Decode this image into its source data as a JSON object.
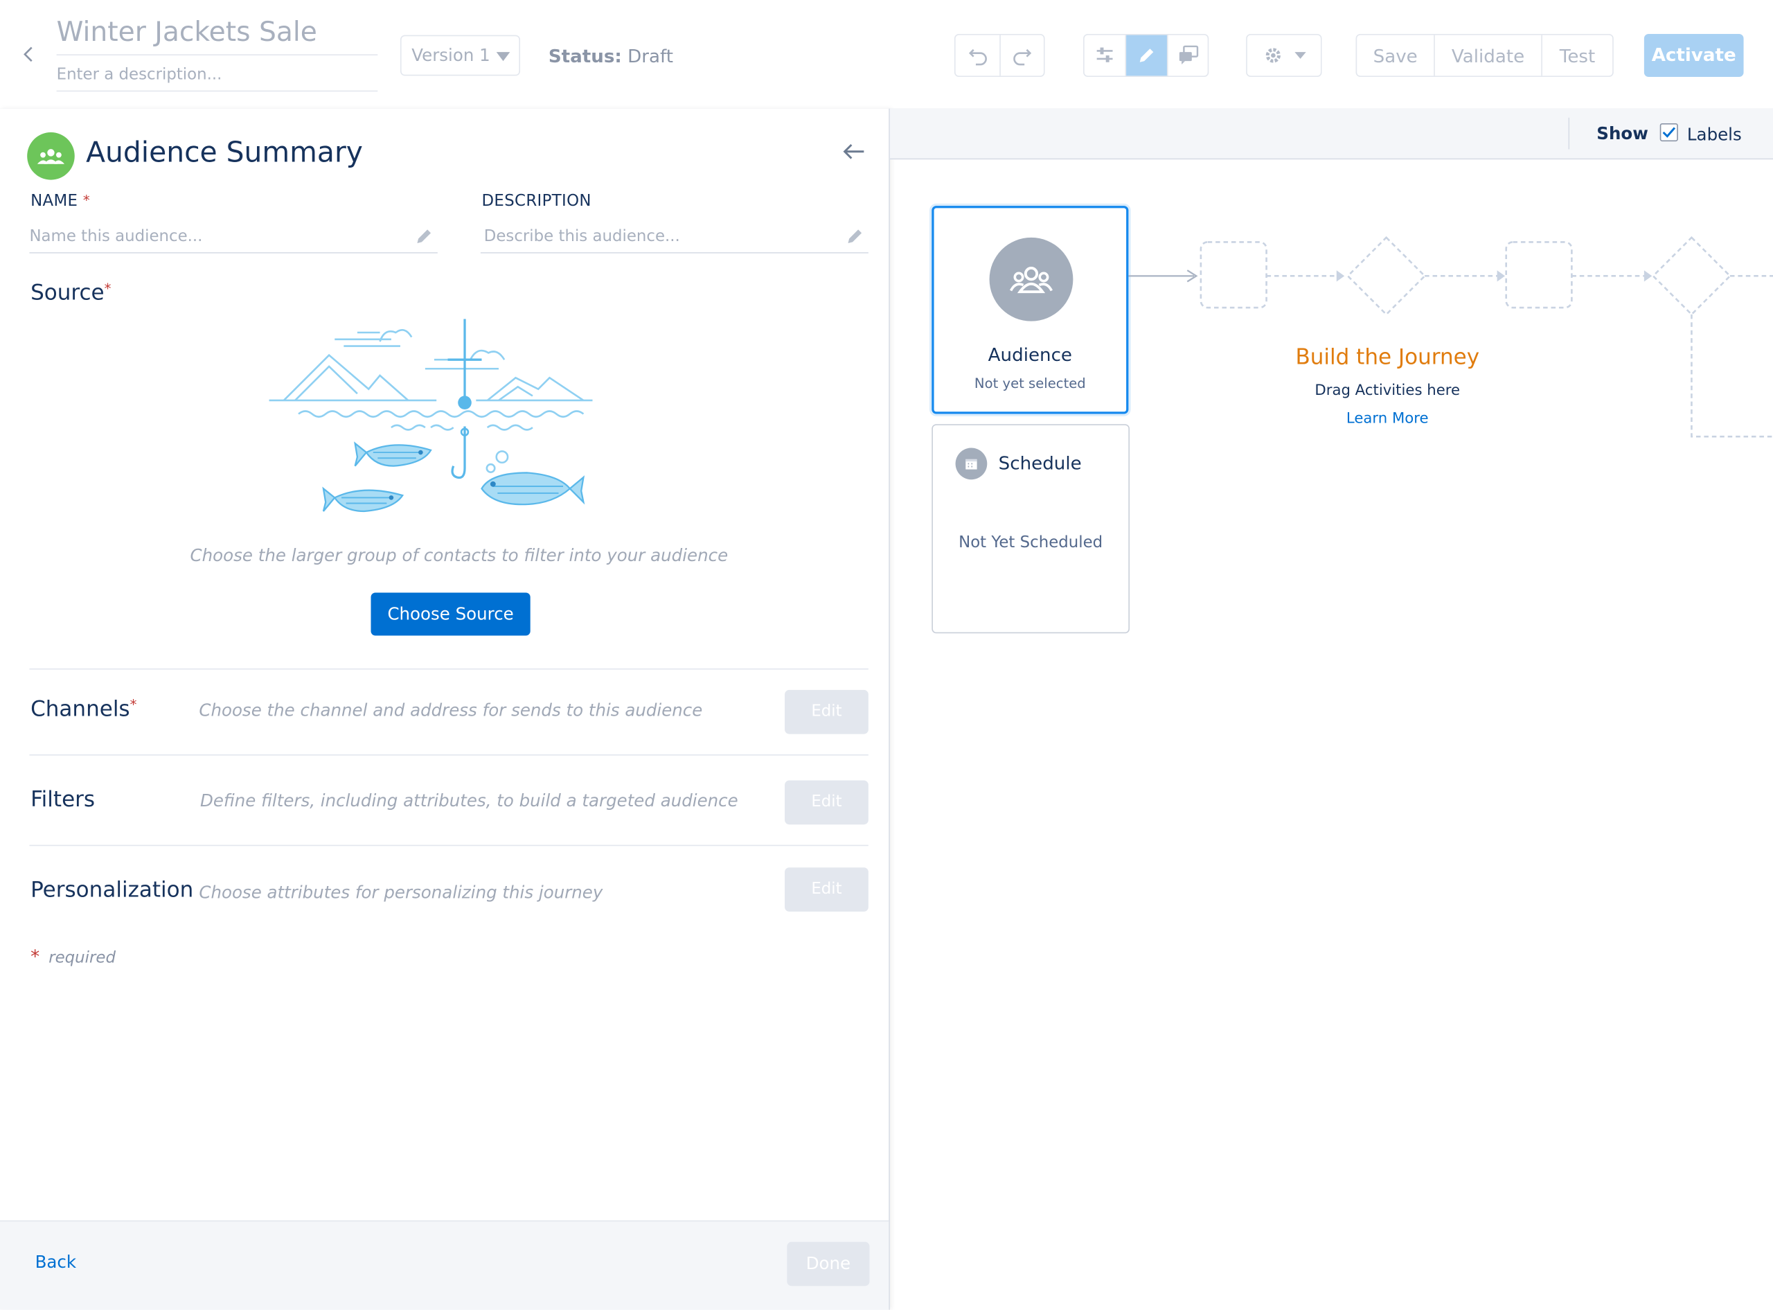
{
  "header": {
    "title": "Winter Jackets Sale",
    "description_placeholder": "Enter a description...",
    "version": "Version 1",
    "status_label": "Status:",
    "status_value": "Draft",
    "save_label": "Save",
    "validate_label": "Validate",
    "test_label": "Test",
    "activate_label": "Activate",
    "icons": [
      "undo-icon",
      "redo-icon",
      "settings-sliders-icon",
      "pencil-icon",
      "comments-icon",
      "gear-icon",
      "chevron-down-icon"
    ]
  },
  "panel": {
    "title": "Audience Summary",
    "name_label": "NAME",
    "name_placeholder": "Name this audience...",
    "description_label": "DESCRIPTION",
    "description_placeholder": "Describe this audience...",
    "source_title": "Source",
    "source_help": "Choose the larger group of contacts to filter into your audience",
    "choose_source_label": "Choose Source",
    "rows": [
      {
        "title": "Channels",
        "required": true,
        "desc": "Choose the channel and address for sends to this audience",
        "edit": "Edit"
      },
      {
        "title": "Filters",
        "required": false,
        "desc": "Define filters, including attributes, to build a targeted audience",
        "edit": "Edit"
      },
      {
        "title": "Personalization",
        "required": false,
        "desc": "Choose attributes for personalizing this journey",
        "edit": "Edit"
      }
    ],
    "required_asterisk": "*",
    "required_note": "required",
    "footer_back": "Back",
    "footer_done": "Done"
  },
  "canvas": {
    "show_label": "Show",
    "labels_label": "Labels",
    "labels_checked": true,
    "audience_title": "Audience",
    "audience_sub": "Not yet selected",
    "schedule_title": "Schedule",
    "schedule_sub": "Not Yet Scheduled",
    "build_title": "Build the Journey",
    "build_sub": "Drag Activities here",
    "learn_more": "Learn More"
  },
  "colors": {
    "brand_blue": "#0070d2",
    "disabled_blue": "#a9d1f3",
    "audience_green": "#6dc55a",
    "build_orange": "#e07c0e",
    "required_red": "#c23934"
  }
}
